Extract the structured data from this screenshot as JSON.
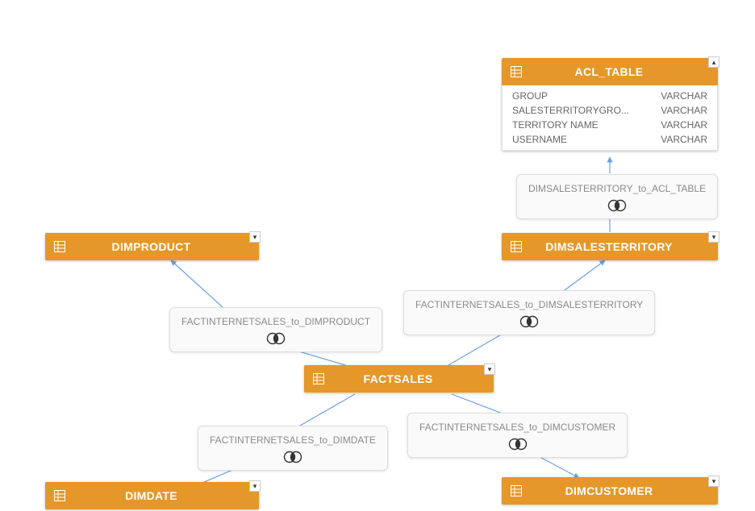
{
  "colors": {
    "entity_bg": "#e69729",
    "entity_fg": "#ffffff",
    "canvas_bg": "#ffffff",
    "join_label": "#8a8a8a",
    "connector": "#6aa0e8"
  },
  "entities": {
    "acl_table": {
      "title": "ACL_TABLE",
      "columns": [
        {
          "name": "GROUP",
          "type": "VARCHAR"
        },
        {
          "name": "SALESTERRITORYGRO...",
          "type": "VARCHAR"
        },
        {
          "name": "TERRITORY NAME",
          "type": "VARCHAR"
        },
        {
          "name": "USERNAME",
          "type": "VARCHAR"
        }
      ]
    },
    "dimproduct": {
      "title": "DIMPRODUCT"
    },
    "dimsalesterritory": {
      "title": "DIMSALESTERRITORY"
    },
    "factsales": {
      "title": "FACTSALES"
    },
    "dimdate": {
      "title": "DIMDATE"
    },
    "dimcustomer": {
      "title": "DIMCUSTOMER"
    }
  },
  "joins": {
    "fis_dimproduct": {
      "label": "FACTINTERNETSALES_to_DIMPRODUCT"
    },
    "fis_dimsalesterritory": {
      "label": "FACTINTERNETSALES_to_DIMSALESTERRITORY"
    },
    "fis_dimdate": {
      "label": "FACTINTERNETSALES_to_DIMDATE"
    },
    "fis_dimcustomer": {
      "label": "FACTINTERNETSALES_to_DIMCUSTOMER"
    },
    "dst_acltable": {
      "label": "DIMSALESTERRITORY_to_ACL_TABLE"
    }
  },
  "chart_data": {
    "type": "diagram",
    "title": "Star-schema data model",
    "nodes": [
      {
        "id": "ACL_TABLE",
        "kind": "table",
        "columns": [
          {
            "name": "GROUP",
            "type": "VARCHAR"
          },
          {
            "name": "SALESTERRITORYGRO...",
            "type": "VARCHAR"
          },
          {
            "name": "TERRITORY NAME",
            "type": "VARCHAR"
          },
          {
            "name": "USERNAME",
            "type": "VARCHAR"
          }
        ]
      },
      {
        "id": "DIMPRODUCT",
        "kind": "table"
      },
      {
        "id": "DIMSALESTERRITORY",
        "kind": "table"
      },
      {
        "id": "FACTSALES",
        "kind": "table"
      },
      {
        "id": "DIMDATE",
        "kind": "table"
      },
      {
        "id": "DIMCUSTOMER",
        "kind": "table"
      }
    ],
    "edges": [
      {
        "from": "FACTSALES",
        "to": "DIMPRODUCT",
        "join": "inner",
        "label": "FACTINTERNETSALES_to_DIMPRODUCT"
      },
      {
        "from": "FACTSALES",
        "to": "DIMSALESTERRITORY",
        "join": "inner",
        "label": "FACTINTERNETSALES_to_DIMSALESTERRITORY"
      },
      {
        "from": "FACTSALES",
        "to": "DIMDATE",
        "join": "inner",
        "label": "FACTINTERNETSALES_to_DIMDATE"
      },
      {
        "from": "FACTSALES",
        "to": "DIMCUSTOMER",
        "join": "inner",
        "label": "FACTINTERNETSALES_to_DIMCUSTOMER"
      },
      {
        "from": "DIMSALESTERRITORY",
        "to": "ACL_TABLE",
        "join": "inner",
        "label": "DIMSALESTERRITORY_to_ACL_TABLE"
      }
    ]
  }
}
